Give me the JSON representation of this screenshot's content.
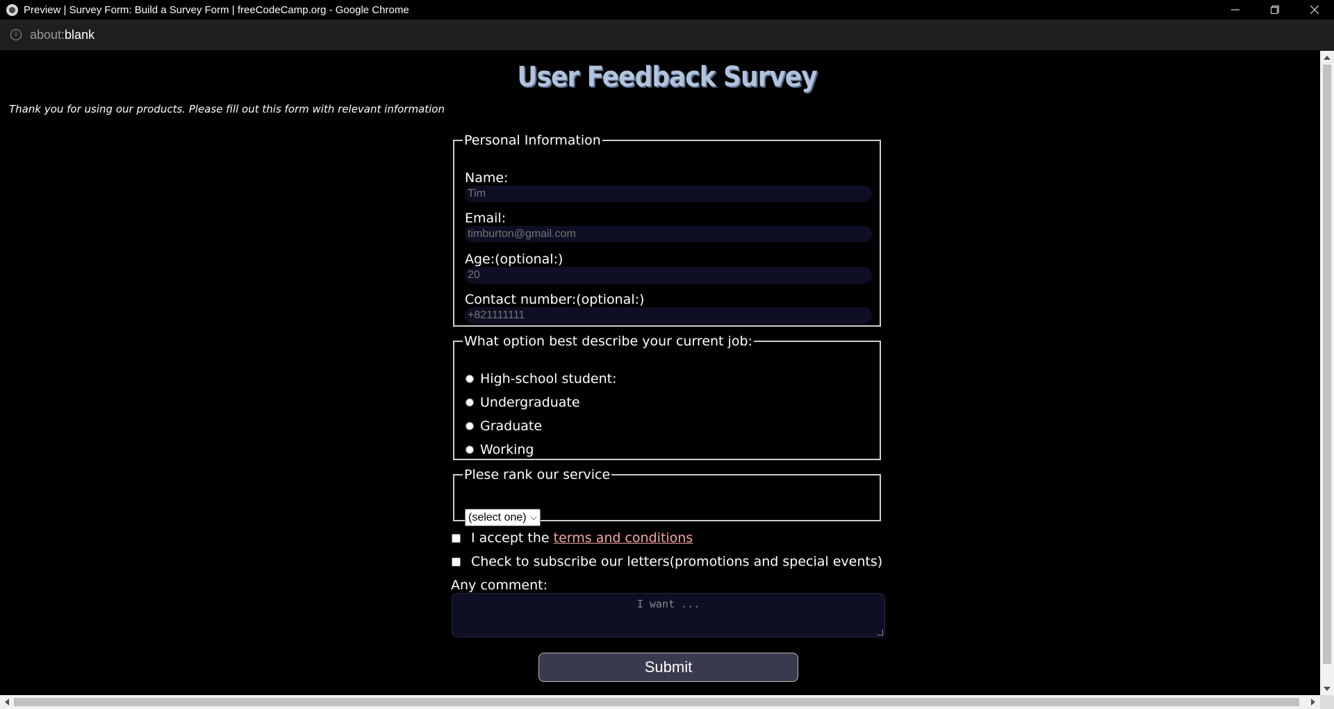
{
  "window": {
    "title": "Preview | Survey Form: Build a Survey Form | freeCodeCamp.org - Google Chrome",
    "controls": [
      "minimize-icon",
      "restore-icon",
      "close-icon"
    ]
  },
  "address_bar": {
    "url_scheme": "about:",
    "url_path": "blank",
    "info_icon": "info-icon"
  },
  "page": {
    "title": "User Feedback Survey",
    "description": "Thank you for using our products. Please fill out this form with relevant information",
    "personal": {
      "legend": "Personal Information",
      "name_label": "Name:",
      "name_placeholder": "Tim",
      "email_label": "Email:",
      "email_placeholder": "timburton@gmail.com",
      "age_label": "Age:(optional:)",
      "age_placeholder": "20",
      "contact_label": "Contact number:(optional:)",
      "contact_placeholder": "+821111111"
    },
    "job": {
      "legend": "What option best describe your current job:",
      "options": [
        "High-school student:",
        "Undergraduate",
        "Graduate",
        "Working"
      ]
    },
    "rank": {
      "legend": "Plese rank our service",
      "selected": "(select one)"
    },
    "terms": {
      "prefix": "I accept the ",
      "link": "terms and conditions"
    },
    "subscribe_label": "Check to subscribe our letters(promotions and special events)",
    "comment": {
      "label": "Any comment:",
      "placeholder": "I want ..."
    },
    "submit_label": "Submit"
  },
  "colors": {
    "background": "#000000",
    "title": "#b0c4de",
    "input_bg": "#0e0e24",
    "link": "#f4a6a6",
    "button_bg": "#3a3a4e"
  }
}
